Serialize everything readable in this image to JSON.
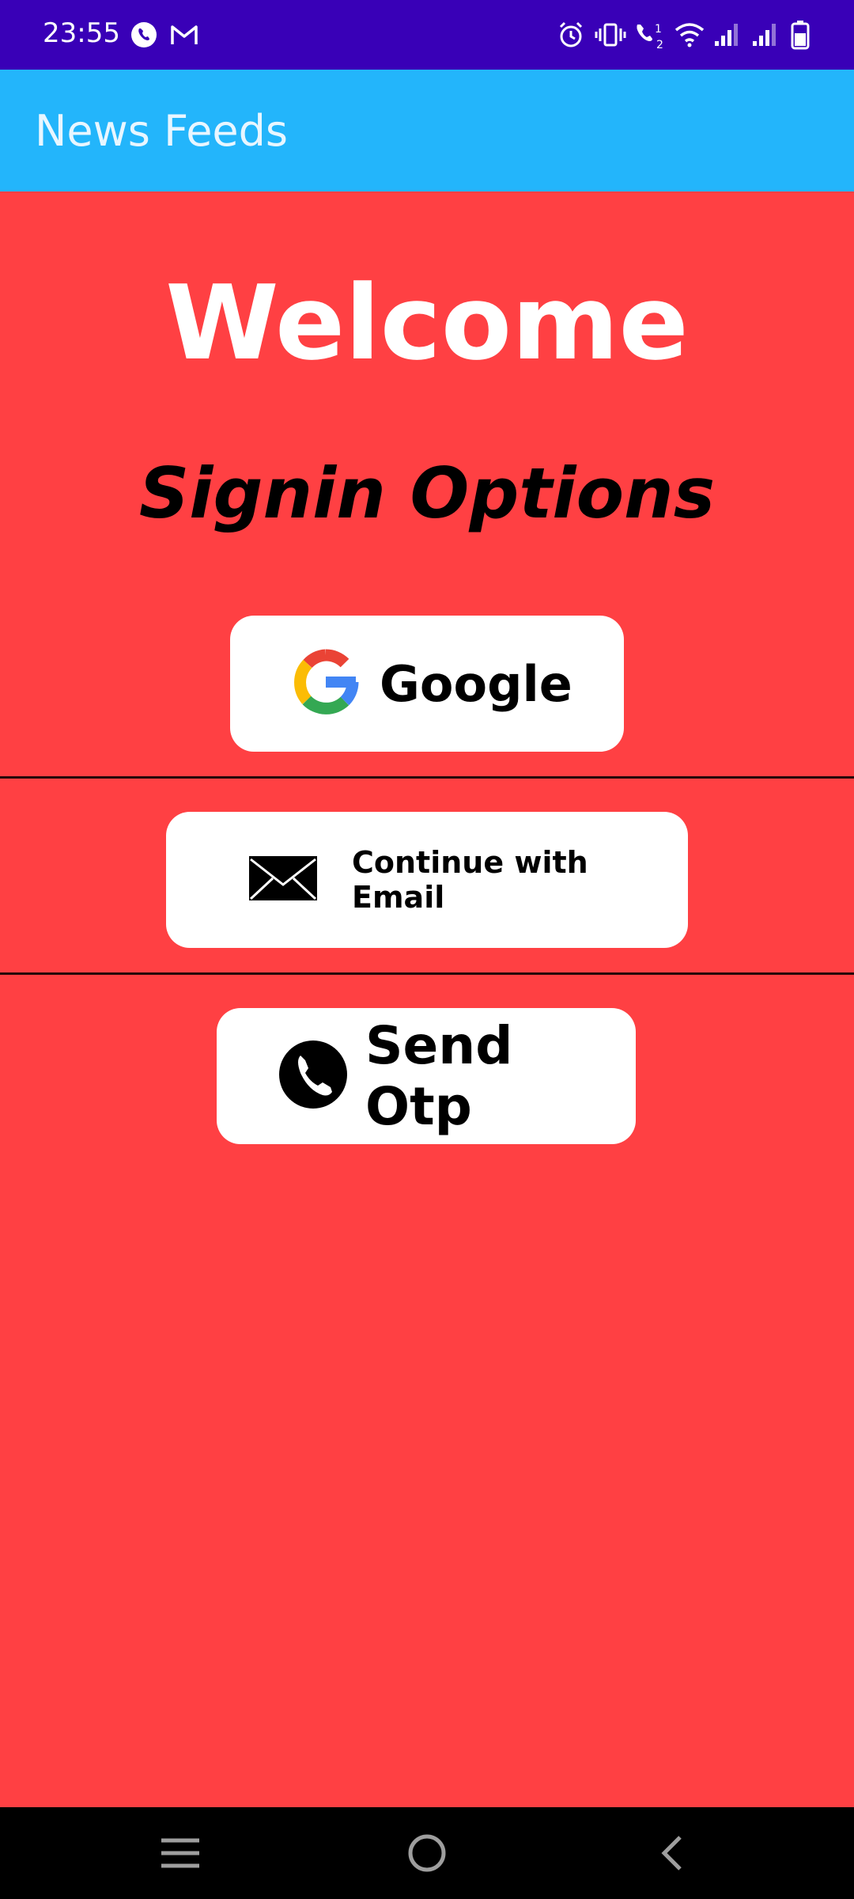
{
  "status_bar": {
    "time": "23:55",
    "left_icons": [
      "whatsapp-icon",
      "gmail-icon"
    ],
    "right_icons": [
      "alarm-icon",
      "vibrate-icon",
      "wifi-calling-icon",
      "wifi-icon",
      "signal-icon",
      "signal-icon",
      "battery-icon"
    ]
  },
  "app_bar": {
    "title": "News Feeds"
  },
  "main": {
    "welcome": "Welcome",
    "subtitle": "Signin Options",
    "buttons": {
      "google": {
        "label": "Google",
        "icon": "google-icon"
      },
      "email": {
        "label": "Continue with Email",
        "icon": "envelope-icon"
      },
      "otp": {
        "label": "Send Otp",
        "icon": "phone-icon"
      }
    }
  },
  "nav_bar": {
    "icons": [
      "menu-icon",
      "home-icon",
      "back-icon"
    ]
  },
  "colors": {
    "status_bar": "#3900b7",
    "app_bar": "#23b5fb",
    "background": "#ff4043",
    "button": "#ffffff",
    "nav_bar": "#000000"
  }
}
